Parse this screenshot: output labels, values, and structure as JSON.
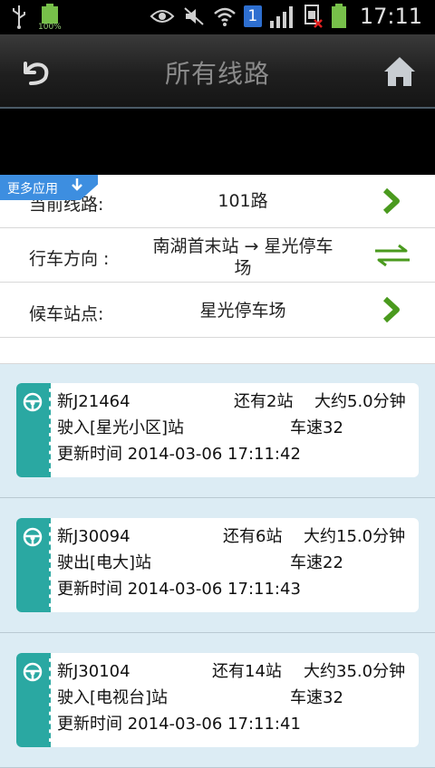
{
  "status_bar": {
    "battery_percent_label": "100%",
    "sim_label": "1",
    "time": "17:11",
    "icons": [
      "usb-icon",
      "battery-icon",
      "eye-icon",
      "mute-icon",
      "wifi-icon",
      "sim-icon",
      "signal-icon",
      "no-sim-icon",
      "battery-charging-icon"
    ]
  },
  "title_bar": {
    "title": "所有线路",
    "back_icon": "back-icon",
    "home_icon": "home-icon"
  },
  "more_apps": {
    "label": "更多应用"
  },
  "route_info": {
    "current_line_label": "当前线路:",
    "current_line_value": "101路",
    "direction_label": "行车方向 :",
    "direction_value_line1": "南湖首末站 → 星光停车",
    "direction_value_line2": "场",
    "stop_label": "候车站点:",
    "stop_value": "星光停车场"
  },
  "buses": [
    {
      "plate": "新J21464",
      "stops_left": "还有2站",
      "eta": "大约5.0分钟",
      "status": "驶入[星光小区]站",
      "speed": "车速32",
      "updated": "更新时间 2014-03-06 17:11:42"
    },
    {
      "plate": "新J30094",
      "stops_left": "还有6站",
      "eta": "大约15.0分钟",
      "status": "驶出[电大]站",
      "speed": "车速22",
      "updated": "更新时间 2014-03-06 17:11:43"
    },
    {
      "plate": "新J30104",
      "stops_left": "还有14站",
      "eta": "大约35.0分钟",
      "status": "驶入[电视台]站",
      "speed": "车速32",
      "updated": "更新时间 2014-03-06 17:11:41"
    }
  ],
  "colors": {
    "teal": "#2aa8a2",
    "list_bg": "#dcecf4",
    "arrow_green": "#4a9a1e",
    "more_apps_blue": "#3d8ee0"
  }
}
